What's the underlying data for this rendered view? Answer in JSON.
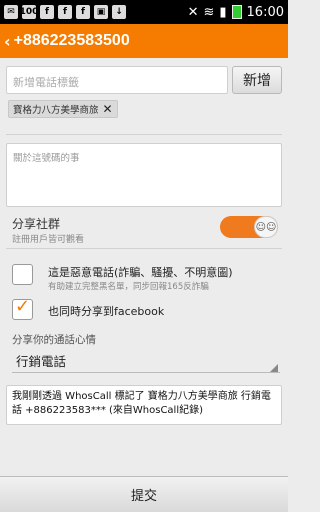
{
  "status_bar": {
    "time": "16:00",
    "left_icons": [
      "sms-icon",
      "app-100-icon",
      "facebook-icon",
      "facebook-icon",
      "facebook-icon",
      "image-icon",
      "download-icon"
    ]
  },
  "header": {
    "title": "+886223583500",
    "accent": "#f57c00"
  },
  "form": {
    "tag_input_placeholder": "新增電話標籤",
    "add_button": "新增",
    "tag": "寶格力八方美學商旅",
    "note_placeholder": "關於這號碼的事",
    "share_group_title": "分享社群",
    "share_group_sub": "註冊用戶皆可觀看",
    "share_group_enabled": true,
    "spam_label": "這是惡意電話(詐騙、騷擾、不明意圖)",
    "spam_sub": "有助建立完整黑名單，同步回報165反詐騙",
    "spam_checked": false,
    "fb_label": "也同時分享到facebook",
    "fb_checked": true,
    "mood_label": "分享你的通話心情",
    "mood_value": "行銷電話",
    "message": "我剛剛透過 WhosCall 標記了 寶格力八方美學商旅 行銷電話 +886223583*** (來自WhosCall紀錄)"
  },
  "footer": {
    "submit": "提交"
  }
}
